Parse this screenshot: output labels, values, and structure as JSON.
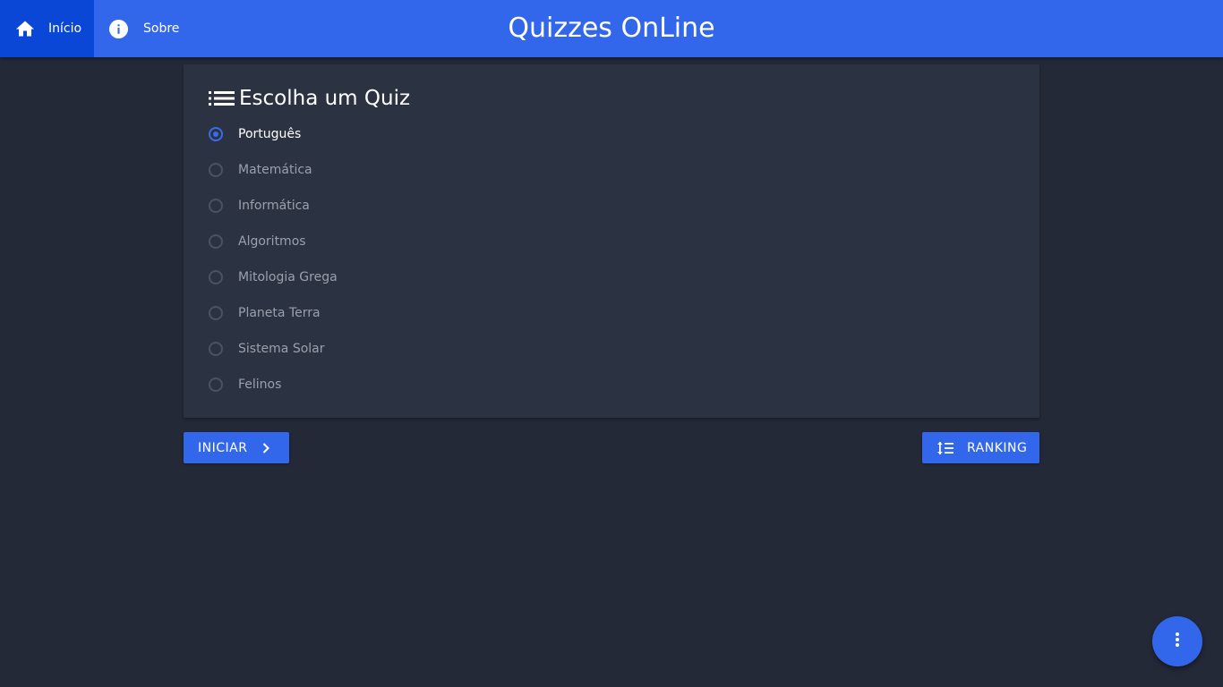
{
  "nav": {
    "tabs": [
      {
        "label": "Início",
        "icon": "home-icon",
        "active": true
      },
      {
        "label": "Sobre",
        "icon": "info-icon",
        "active": false
      }
    ]
  },
  "header": {
    "title": "Quizzes OnLine"
  },
  "quiz_card": {
    "title": "Escolha um Quiz",
    "title_icon": "list-icon",
    "options": [
      {
        "label": "Português",
        "selected": true
      },
      {
        "label": "Matemática",
        "selected": false
      },
      {
        "label": "Informática",
        "selected": false
      },
      {
        "label": "Algoritmos",
        "selected": false
      },
      {
        "label": "Mitologia Grega",
        "selected": false
      },
      {
        "label": "Planeta Terra",
        "selected": false
      },
      {
        "label": "Sistema Solar",
        "selected": false
      },
      {
        "label": "Felinos",
        "selected": false
      }
    ]
  },
  "actions": {
    "start_label": "INICIAR",
    "start_icon": "chevron-right-icon",
    "ranking_label": "RANKING",
    "ranking_icon": "sort-icon"
  },
  "fab": {
    "icon": "more-vertical-icon"
  },
  "colors": {
    "background": "#242938",
    "card": "#2b3242",
    "primary": "#3367eb",
    "active_tab": "#0b47d6"
  }
}
